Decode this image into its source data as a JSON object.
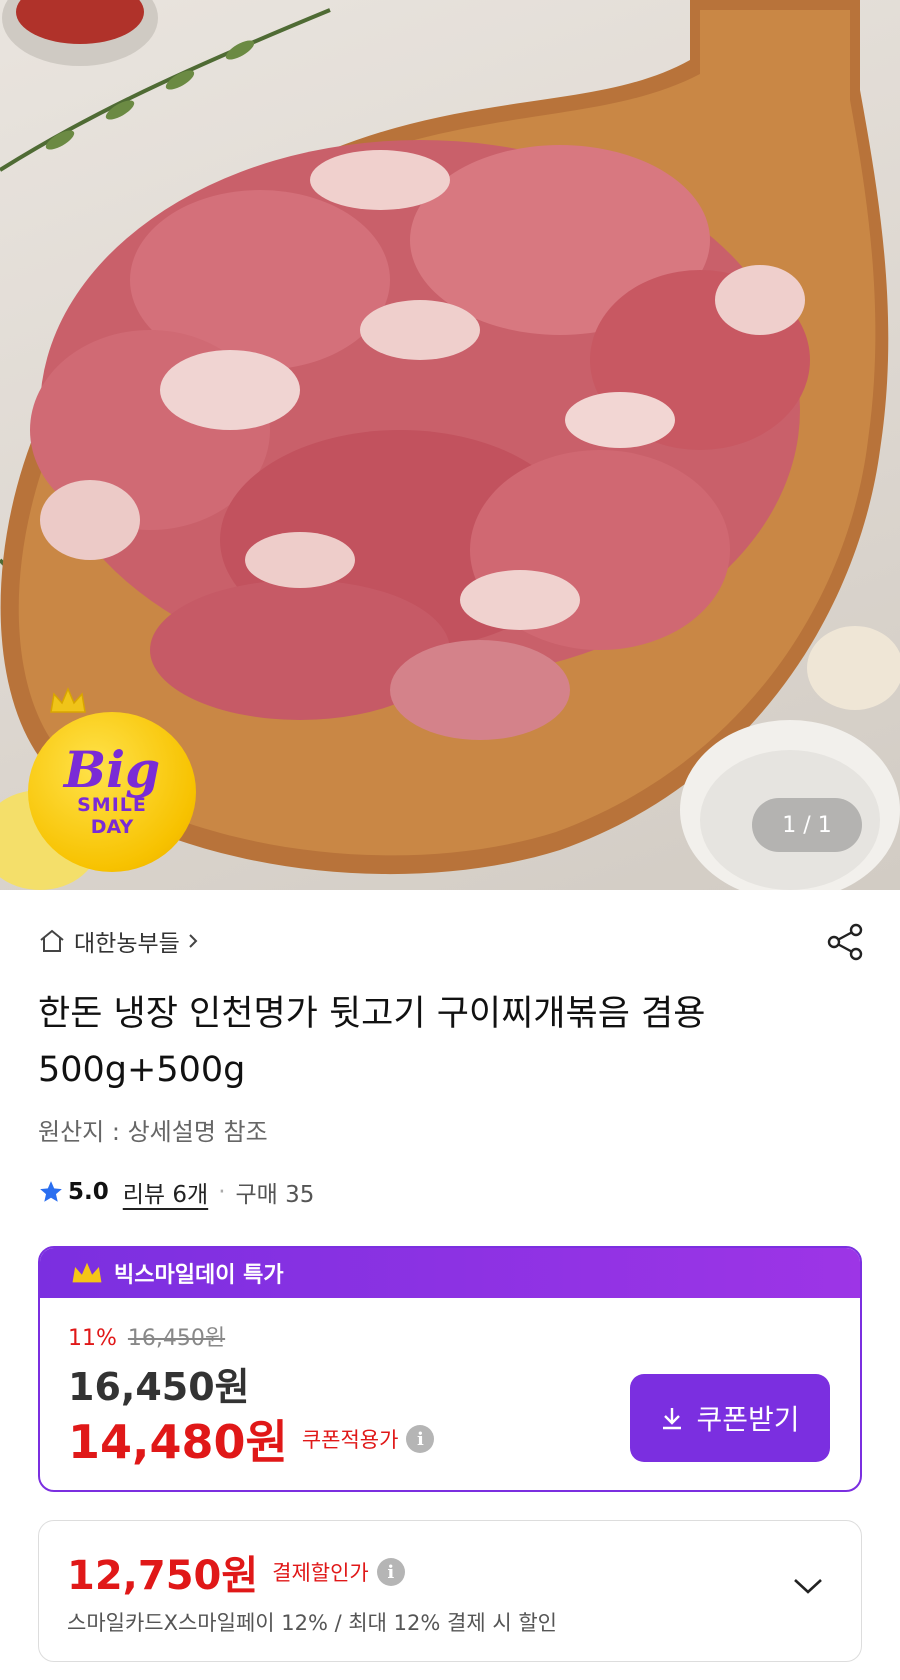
{
  "hero": {
    "badge": {
      "line1": "Big",
      "line2": "SMILE",
      "line3": "DAY"
    },
    "page_indicator": "1 / 1"
  },
  "store": {
    "name": "대한농부들"
  },
  "product": {
    "title": "한돈 냉장 인천명가 뒷고기 구이찌개볶음 겸용 500g+500g",
    "origin": "원산지 : 상세설명 참조",
    "rating": "5.0",
    "reviews": "리뷰 6개",
    "sales": "구매 35"
  },
  "deal": {
    "header": "빅스마일데이 특가",
    "discount_pct": "11%",
    "original_price": "16,450원",
    "price": "16,450원",
    "coupon_price": "14,480원",
    "coupon_label": "쿠폰적용가",
    "coupon_button": "쿠폰받기"
  },
  "payment": {
    "price": "12,750원",
    "label": "결제할인가",
    "description": "스마일카드X스마일페이 12% / 최대 12% 결제 시 할인"
  },
  "colors": {
    "accent": "#7b2fe0",
    "sale_red": "#e01818",
    "badge_yellow": "#f7c200"
  },
  "icons": [
    "home-icon",
    "chevron-right-icon",
    "share-icon",
    "star-icon",
    "crown-icon",
    "info-icon",
    "download-icon",
    "chevron-down-icon"
  ]
}
